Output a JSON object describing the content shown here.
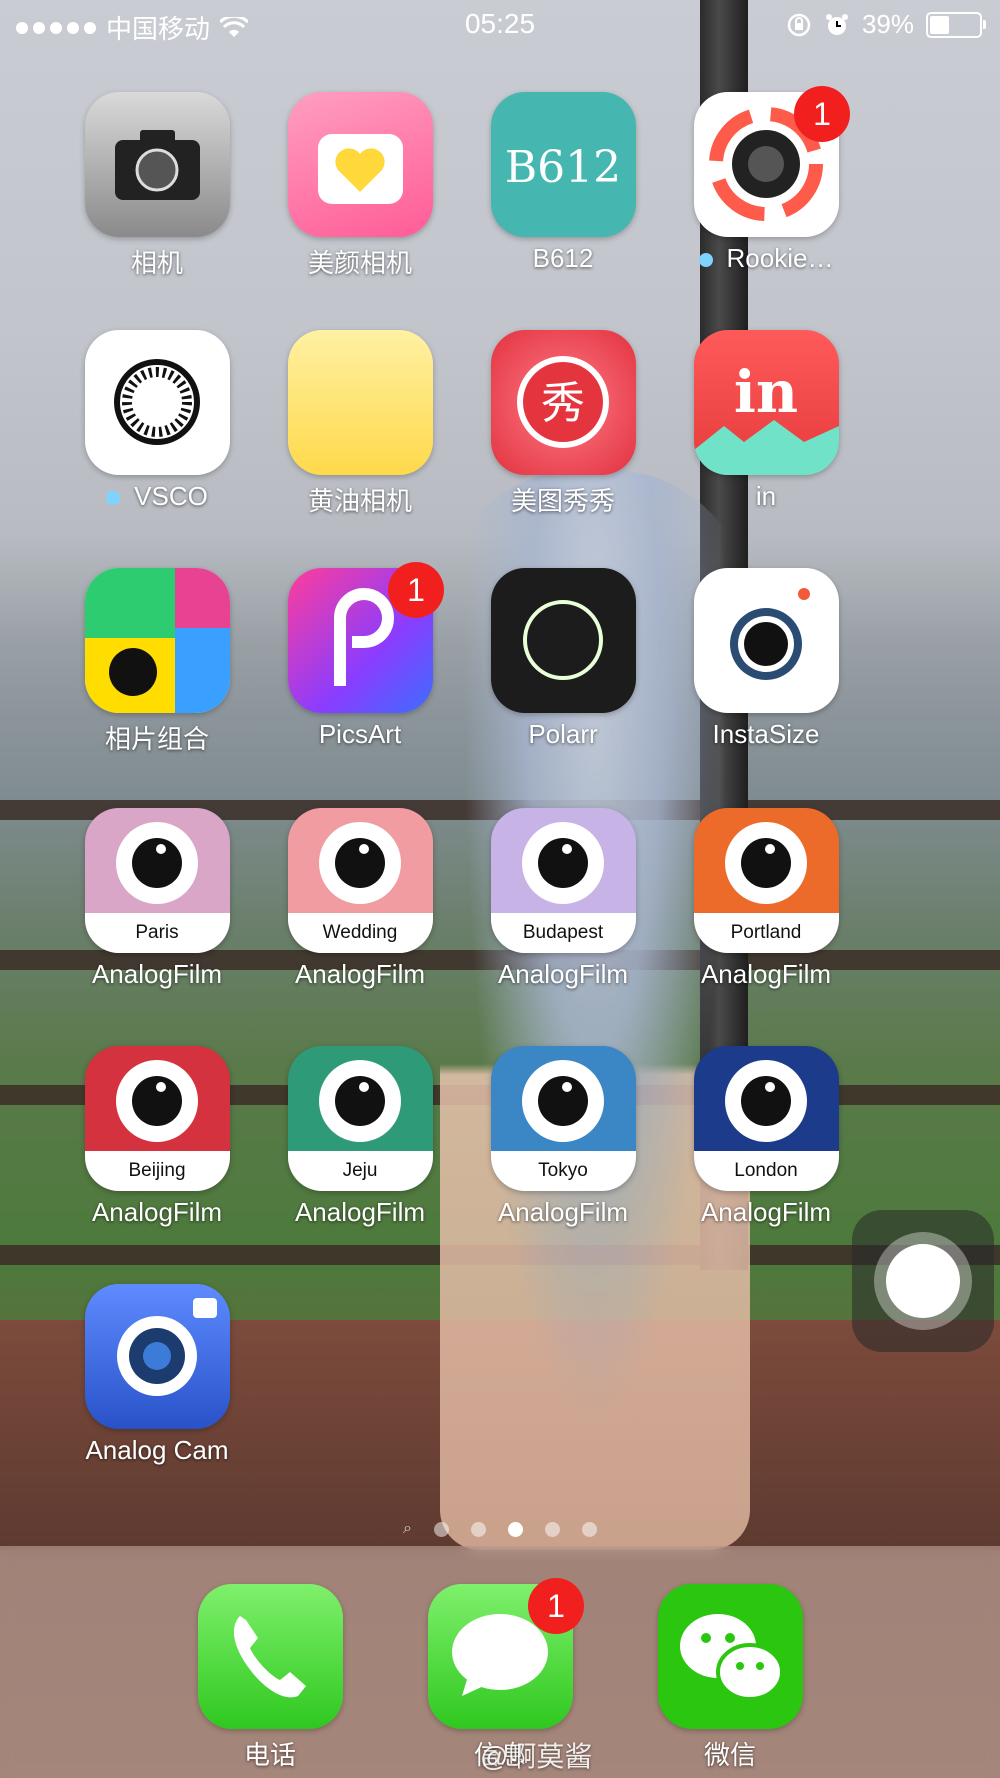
{
  "status_bar": {
    "carrier": "中国移动",
    "time": "05:25",
    "battery": "39%",
    "battery_level": 0.39,
    "icons": [
      "signal-dots-icon",
      "wifi-icon",
      "orientation-lock-icon",
      "alarm-icon",
      "battery-icon"
    ]
  },
  "apps": [
    {
      "label": "相机",
      "icon": "camera-icon"
    },
    {
      "label": "美颜相机",
      "icon": "beauty-camera-icon"
    },
    {
      "label": "B612",
      "icon": "b612-icon",
      "icon_text": "B612"
    },
    {
      "label": "Rookie…",
      "icon": "rookie-lens-icon",
      "badge": "1",
      "new": true
    },
    {
      "label": "VSCO",
      "icon": "vsco-icon",
      "new": true
    },
    {
      "label": "黄油相机",
      "icon": "butter-camera-icon"
    },
    {
      "label": "美图秀秀",
      "icon": "meitu-icon",
      "icon_text": "秀"
    },
    {
      "label": "in",
      "icon": "in-icon",
      "icon_text": "in"
    },
    {
      "label": "相片组合",
      "icon": "pic-collage-icon"
    },
    {
      "label": "PicsArt",
      "icon": "picsart-icon",
      "badge": "1"
    },
    {
      "label": "Polarr",
      "icon": "polarr-icon"
    },
    {
      "label": "InstaSize",
      "icon": "instasize-icon"
    },
    {
      "label": "AnalogFilm",
      "icon": "analogfilm-eye-icon",
      "sub": "Paris",
      "color": "#d9a6c8"
    },
    {
      "label": "AnalogFilm",
      "icon": "analogfilm-eye-icon",
      "sub": "Wedding",
      "color": "#f09ca0"
    },
    {
      "label": "AnalogFilm",
      "icon": "analogfilm-eye-icon",
      "sub": "Budapest",
      "color": "#c7b3e6"
    },
    {
      "label": "AnalogFilm",
      "icon": "analogfilm-eye-icon",
      "sub": "Portland",
      "color": "#ec6a2a"
    },
    {
      "label": "AnalogFilm",
      "icon": "analogfilm-eye-icon",
      "sub": "Beijing",
      "color": "#d4323f"
    },
    {
      "label": "AnalogFilm",
      "icon": "analogfilm-eye-icon",
      "sub": "Jeju",
      "color": "#2f9a78"
    },
    {
      "label": "AnalogFilm",
      "icon": "analogfilm-eye-icon",
      "sub": "Tokyo",
      "color": "#3b86c4"
    },
    {
      "label": "AnalogFilm",
      "icon": "analogfilm-eye-icon",
      "sub": "London",
      "color": "#1c3b8a"
    },
    {
      "label": "Analog Cam",
      "icon": "analog-cam-icon"
    }
  ],
  "page_indicator": {
    "pages": 5,
    "current": 3,
    "search_glyph": "🔍"
  },
  "dock": [
    {
      "label": "电话",
      "icon": "phone-icon"
    },
    {
      "label": "信息",
      "icon": "messages-icon",
      "badge": "1"
    },
    {
      "label": "微信",
      "icon": "wechat-icon"
    }
  ],
  "watermark": "@啊莫酱",
  "colors": {
    "badge": "#f21f1f",
    "new_dot": "#7fd3ff"
  }
}
